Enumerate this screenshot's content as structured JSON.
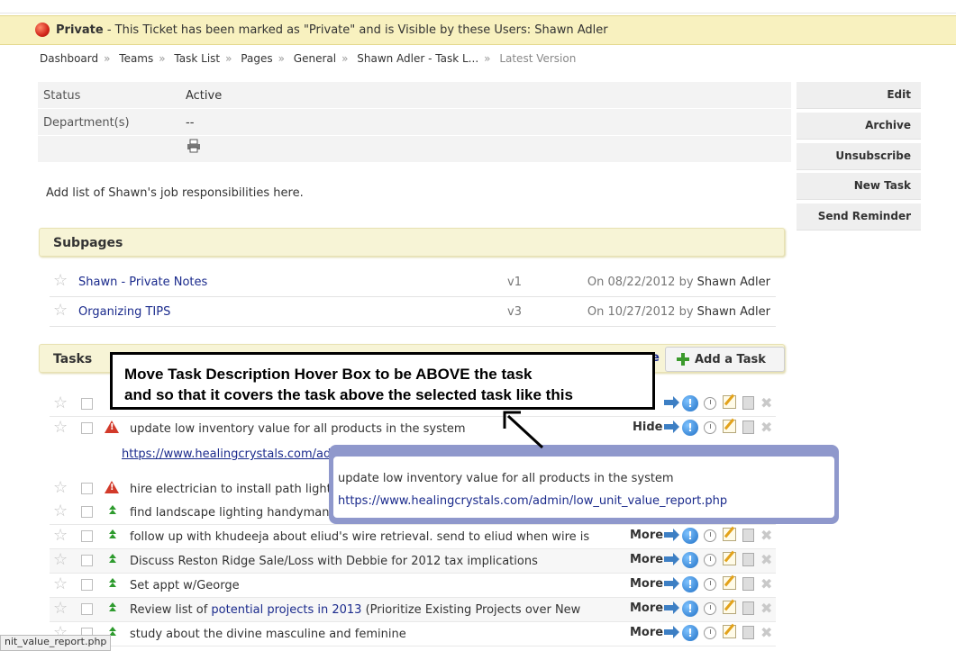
{
  "banner": {
    "strong": "Private",
    "text": " - This Ticket has been marked as \"Private\" and is Visible by these Users: Shawn Adler"
  },
  "breadcrumbs": [
    "Dashboard",
    "Teams",
    "Task List",
    "Pages",
    "General",
    "Shawn Adler - Task L..."
  ],
  "breadcrumb_sep": "»",
  "breadcrumb_current": "Latest Version",
  "properties": [
    {
      "label": "Status",
      "value": "Active"
    },
    {
      "label": "Department(s)",
      "value": "--"
    }
  ],
  "description": "Add list of Shawn's job responsibilities here.",
  "sidebar_buttons": [
    "Edit",
    "Archive",
    "Unsubscribe",
    "New Task",
    "Send Reminder"
  ],
  "subpages": {
    "heading": "Subpages",
    "items": [
      {
        "title": "Shawn - Private Notes",
        "version": "v1",
        "date": "On 08/22/2012 by",
        "author": "Shawn Adler"
      },
      {
        "title": "Organizing TIPS",
        "version": "v3",
        "date": "On 10/27/2012 by",
        "author": "Shawn Adler"
      }
    ]
  },
  "tasks": {
    "heading": "Tasks",
    "add_label": "Add a Task",
    "partial_link": "e",
    "items": [
      {
        "title": "",
        "action": ""
      },
      {
        "title": "update low inventory value for all products in the system",
        "action": "Hide",
        "priority": "high"
      },
      {
        "title": "hire electrician to install path lights",
        "action": "",
        "priority": "high"
      },
      {
        "title": "find landscape lighting handyman",
        "action": "",
        "priority": "up"
      },
      {
        "title": "follow up with khudeeja about eliud's wire retrieval.  send to eliud when wire is",
        "action": "More",
        "priority": "up"
      },
      {
        "title": "Discuss Reston Ridge Sale/Loss with Debbie for 2012 tax implications",
        "action": "More",
        "priority": "up"
      },
      {
        "title": "Set appt w/George",
        "action": "More",
        "priority": "up"
      },
      {
        "title_pre": "Review list of ",
        "title_link": "potential projects in 2013",
        "title_post": " (Prioritize Existing Projects over New",
        "action": "More",
        "priority": "up"
      },
      {
        "title": "study about the divine masculine and feminine",
        "action": "More",
        "priority": "up"
      }
    ],
    "expanded_url": "https://www.healingcrystals.com/admin/low_unit_value_report.php"
  },
  "hover_box": {
    "line1": "update low inventory value for all products in the system",
    "line2": "https://www.healingcrystals.com/admin/low_unit_value_report.php"
  },
  "annotation": {
    "line1": "Move Task Description Hover Box to be ABOVE the task",
    "line2": "and so that it covers the task above the selected task like this"
  },
  "status_bar": "nit_value_report.php",
  "colors": {
    "banner_bg": "#f8f1bf",
    "link": "#1a2a8c",
    "hover_border": "#8f98cc"
  }
}
